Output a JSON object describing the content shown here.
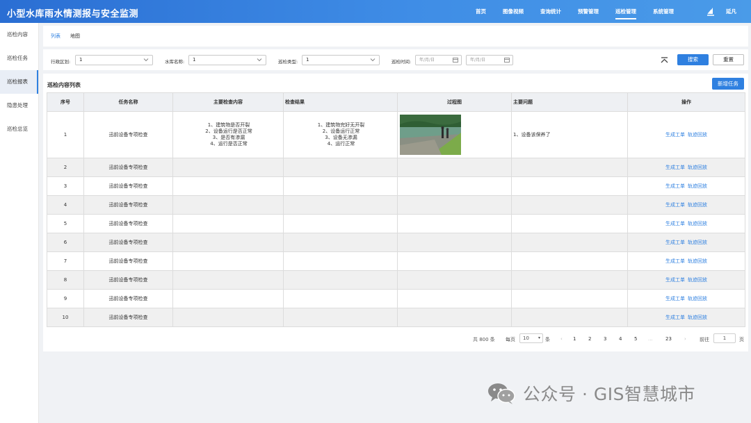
{
  "app": {
    "title": "小型水库雨水情测报与安全监测"
  },
  "nav": {
    "items": [
      {
        "label": "首页"
      },
      {
        "label": "图像视频"
      },
      {
        "label": "查询统计"
      },
      {
        "label": "预警管理"
      },
      {
        "label": "巡检管理"
      },
      {
        "label": "系统管理"
      }
    ],
    "active": "巡检管理"
  },
  "user": {
    "name": "延凡",
    "icon": "user-logo-icon"
  },
  "sidebar": {
    "items": [
      {
        "label": "巡检内容"
      },
      {
        "label": "巡检任务"
      },
      {
        "label": "巡检报表"
      },
      {
        "label": "隐患处理"
      },
      {
        "label": "巡检总览"
      }
    ],
    "active": "巡检报表"
  },
  "tabs": {
    "items": [
      {
        "label": "列表"
      },
      {
        "label": "地图"
      }
    ],
    "active": "列表"
  },
  "filters": {
    "region": {
      "label": "行政区划:",
      "value": "1"
    },
    "reservoir": {
      "label": "水库名称:",
      "value": "1"
    },
    "inspect_type": {
      "label": "巡检类型:",
      "value": "1"
    },
    "time": {
      "label": "巡检时间:",
      "start_placeholder": "年/月/日",
      "end_placeholder": "年/月/日"
    },
    "search_label": "搜索",
    "reset_label": "重置"
  },
  "list": {
    "title": "巡检内容列表",
    "add_label": "新增任务",
    "columns": [
      "序号",
      "任务名称",
      "主要检查内容",
      "检查结果",
      "过程图",
      "主要问题",
      "操作"
    ],
    "rows": [
      {
        "no": "1",
        "name": "迅前设备专项检查",
        "content": "1、建筑物是否开裂\n2、设备运行是否正常\n3、是否有渗漏\n4、运行是否正常",
        "result": "1、建筑物完好无开裂\n2、设备运行正常\n3、设备无渗漏\n4、运行正常",
        "has_photo": true,
        "problem": "1、设备该保养了"
      },
      {
        "no": "2",
        "name": "迅前设备专项检查",
        "content": "",
        "result": "",
        "has_photo": false,
        "problem": ""
      },
      {
        "no": "3",
        "name": "迅前设备专项检查",
        "content": "",
        "result": "",
        "has_photo": false,
        "problem": ""
      },
      {
        "no": "4",
        "name": "迅前设备专项检查",
        "content": "",
        "result": "",
        "has_photo": false,
        "problem": ""
      },
      {
        "no": "5",
        "name": "迅前设备专项检查",
        "content": "",
        "result": "",
        "has_photo": false,
        "problem": ""
      },
      {
        "no": "6",
        "name": "迅前设备专项检查",
        "content": "",
        "result": "",
        "has_photo": false,
        "problem": ""
      },
      {
        "no": "7",
        "name": "迅前设备专项检查",
        "content": "",
        "result": "",
        "has_photo": false,
        "problem": ""
      },
      {
        "no": "8",
        "name": "迅前设备专项检查",
        "content": "",
        "result": "",
        "has_photo": false,
        "problem": ""
      },
      {
        "no": "9",
        "name": "迅前设备专项检查",
        "content": "",
        "result": "",
        "has_photo": false,
        "problem": ""
      },
      {
        "no": "10",
        "name": "迅前设备专项检查",
        "content": "",
        "result": "",
        "has_photo": false,
        "problem": ""
      }
    ],
    "actions": [
      "生成工单",
      "轨迹回放"
    ]
  },
  "pagination": {
    "total_text": "共 800 条",
    "per_page_label": "每页",
    "per_page_value": "10",
    "per_page_unit": "条",
    "prev": "‹",
    "pages": [
      "1",
      "2",
      "3",
      "4",
      "5",
      "...",
      "23"
    ],
    "next": "›",
    "goto_label": "前往",
    "goto_value": "1",
    "goto_unit": "页"
  },
  "watermark": {
    "text": "公众号 · GIS智慧城市",
    "icon": "wechat-icon"
  },
  "colors": {
    "primary": "#2f80e0",
    "header": "#2a6ed3"
  }
}
